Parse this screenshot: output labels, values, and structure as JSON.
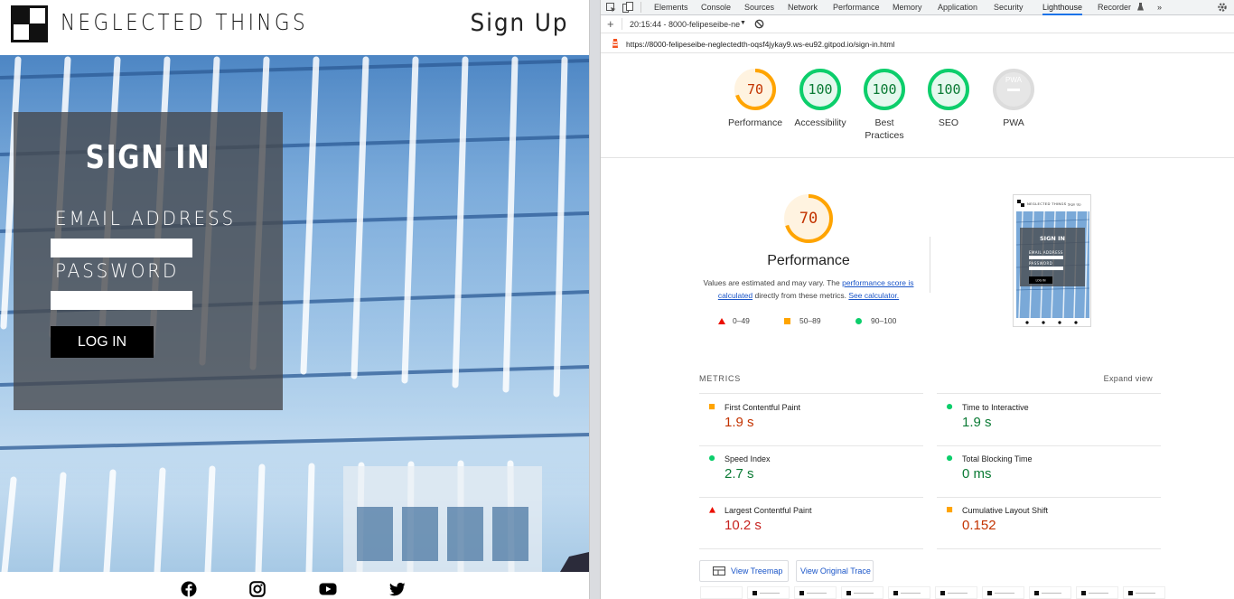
{
  "site": {
    "brand": "NEGLECTED THINGS",
    "signup": "Sign Up",
    "signin_title": "SIGN IN",
    "email_label": "EMAIL ADDRESS",
    "password_label": "PASSWORD",
    "email_value": "",
    "password_value": "",
    "login_label": "LOG IN",
    "social_icons": [
      "facebook-icon",
      "instagram-icon",
      "youtube-icon",
      "twitter-icon"
    ]
  },
  "devtools": {
    "tabs": [
      "Elements",
      "Console",
      "Sources",
      "Network",
      "Performance",
      "Memory",
      "Application",
      "Security",
      "Lighthouse",
      "Recorder"
    ],
    "active_tab": "Lighthouse",
    "more_tabs": "»",
    "report_selector": "20:15:44 - 8000-felipeseibe-ne",
    "url": "https://8000-felipeseibe-neglectedth-oqsf4jykay9.ws-eu92.gitpod.io/sign-in.html"
  },
  "lighthouse": {
    "categories": [
      {
        "label": "Performance",
        "score": "70",
        "fraction": 0.7,
        "status": "average"
      },
      {
        "label": "Accessibility",
        "score": "100",
        "fraction": 1.0,
        "status": "pass"
      },
      {
        "label": "Best Practices",
        "score": "100",
        "fraction": 1.0,
        "status": "pass"
      },
      {
        "label": "SEO",
        "score": "100",
        "fraction": 1.0,
        "status": "pass"
      },
      {
        "label": "PWA",
        "score": "PWA",
        "fraction": 0,
        "status": "na"
      }
    ],
    "perf": {
      "score": "70",
      "title": "Performance",
      "desc_1": "Values are estimated and may vary. The ",
      "desc_link1": "performance score is calculated",
      "desc_2": " directly from these metrics. ",
      "desc_link2": "See calculator."
    },
    "legend": [
      "0–49",
      "50–89",
      "90–100"
    ],
    "metrics_title": "METRICS",
    "expand": "Expand view",
    "metrics": [
      {
        "name": "First Contentful Paint",
        "value": "1.9 s",
        "status": "average"
      },
      {
        "name": "Time to Interactive",
        "value": "1.9 s",
        "status": "pass"
      },
      {
        "name": "Speed Index",
        "value": "2.7 s",
        "status": "pass"
      },
      {
        "name": "Total Blocking Time",
        "value": "0 ms",
        "status": "pass"
      },
      {
        "name": "Largest Contentful Paint",
        "value": "10.2 s",
        "status": "fail"
      },
      {
        "name": "Cumulative Layout Shift",
        "value": "0.152",
        "status": "average"
      }
    ],
    "treemap_btn": "View Treemap",
    "trace_btn": "View Original Trace",
    "thumb": {
      "brand": "NEGLECTED THINGS",
      "signup": "Sign Up",
      "title": "SIGN IN",
      "email": "EMAIL ADDRESS",
      "password": "PASSWORD",
      "login": "LOG IN"
    }
  },
  "colors": {
    "fail": "#eb0f00",
    "average": "#ffa400",
    "pass": "#0cce6b",
    "na": "#b3b3b3",
    "link": "#1a55c8"
  }
}
